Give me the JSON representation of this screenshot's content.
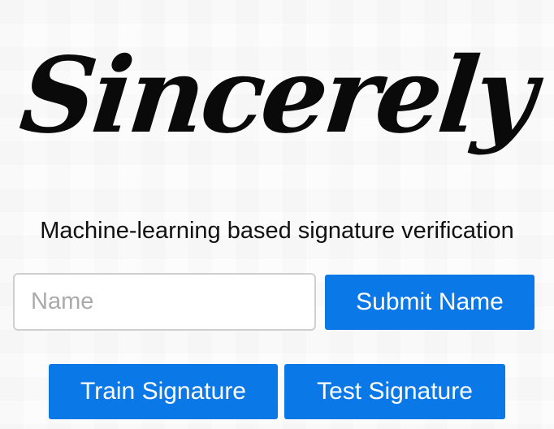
{
  "logo": {
    "text": "Sincerely"
  },
  "tagline": "Machine-learning based signature verification",
  "name_input": {
    "placeholder": "Name",
    "value": ""
  },
  "buttons": {
    "submit_name": "Submit Name",
    "train_signature": "Train Signature",
    "test_signature": "Test Signature"
  },
  "colors": {
    "accent": "#0a78e6"
  }
}
